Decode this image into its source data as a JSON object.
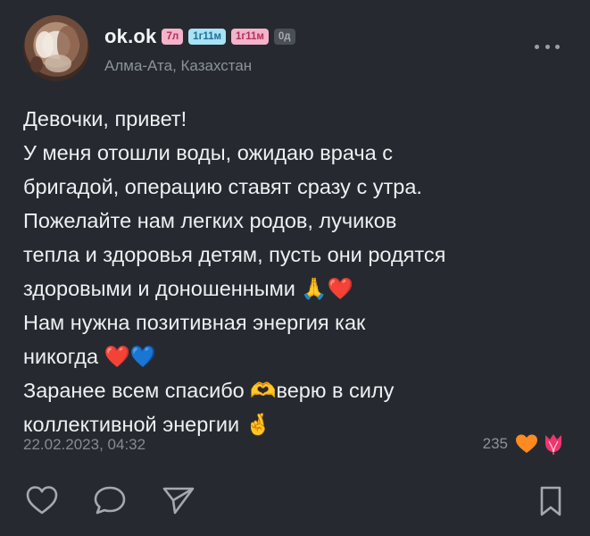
{
  "author": {
    "name": "ok.ok",
    "badges": [
      {
        "text": "7л",
        "style": "pink"
      },
      {
        "text": "1г11м",
        "style": "blue"
      },
      {
        "text": "1г11м",
        "style": "pink"
      },
      {
        "text": "0д",
        "style": "gray"
      }
    ],
    "location": "Алма-Ата, Казахстан"
  },
  "post": {
    "lines": [
      "Девочки, привет!",
      "У меня отошли воды, ожидаю врача с",
      "бригадой, операцию ставят сразу с утра.",
      "Пожелайте нам легких родов, лучиков",
      "тепла и здоровья детям, пусть они родятся",
      "здоровыми и доношенными 🙏❤️",
      "Нам нужна позитивная энергия как",
      "никогда ❤️💙",
      "Заранее всем спасибо 🫶верю в силу",
      "коллективной энергии 🤞"
    ],
    "date": "22.02.2023, 04:32",
    "reaction_count": "235"
  },
  "icons": {
    "more": "more-horizontal-icon",
    "like": "heart-outline-icon",
    "comment": "comment-bubble-icon",
    "share": "send-icon",
    "bookmark": "bookmark-icon",
    "reaction1": "orange-heart-icon",
    "reaction2": "pink-tulip-icon"
  },
  "colors": {
    "background": "#262A30",
    "text": "#EEF0F2",
    "muted": "#858B94",
    "reaction_heart": "#FF8A1F",
    "reaction_flower": "#F0346E"
  }
}
